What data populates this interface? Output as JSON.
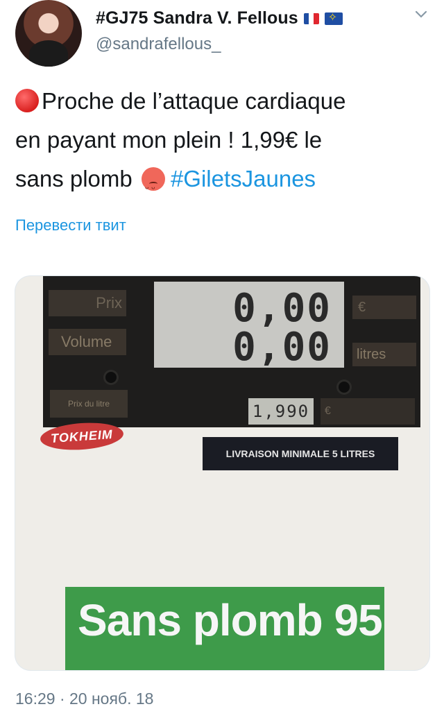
{
  "author": {
    "display_name": "#GJ75 Sandra V. Fellous",
    "handle": "@sandrafellous_",
    "flags": [
      "fr-flag-icon",
      "eu-flag-icon"
    ]
  },
  "tweet": {
    "line1": "Proche de l’attaque  cardiaque",
    "line2": "en payant mon plein ! 1,99€ le",
    "line3_text": "sans plomb",
    "hashtag": "#GiletsJaunes",
    "translate_label": "Перевести твит",
    "timestamp": "16:29 · 20 нояб. 18"
  },
  "photo": {
    "prix_label": "Prix",
    "volume_label": "Volume",
    "euro_label": "€",
    "litres_label": "litres",
    "prix_du_litre_label": "Prix du litre",
    "amount_display": "0,00",
    "volume_display": "0,00",
    "unit_price_display": "1,990",
    "unit_price_currency": "€",
    "brand": "TOKHEIM",
    "livraison_text": "LIVRAISON MINIMALE 5 LITRES",
    "fuel_label": "Sans plomb 95"
  },
  "colors": {
    "link": "#1b95e0",
    "secondary_text": "#657786",
    "fuel_sign_green": "#3e9b4a",
    "brand_red": "#c93a3a"
  },
  "icons": {
    "caret": "chevron-down-icon",
    "red_circle": "red-circle-emoji-icon",
    "angry_face": "angry-face-emoji-icon"
  }
}
